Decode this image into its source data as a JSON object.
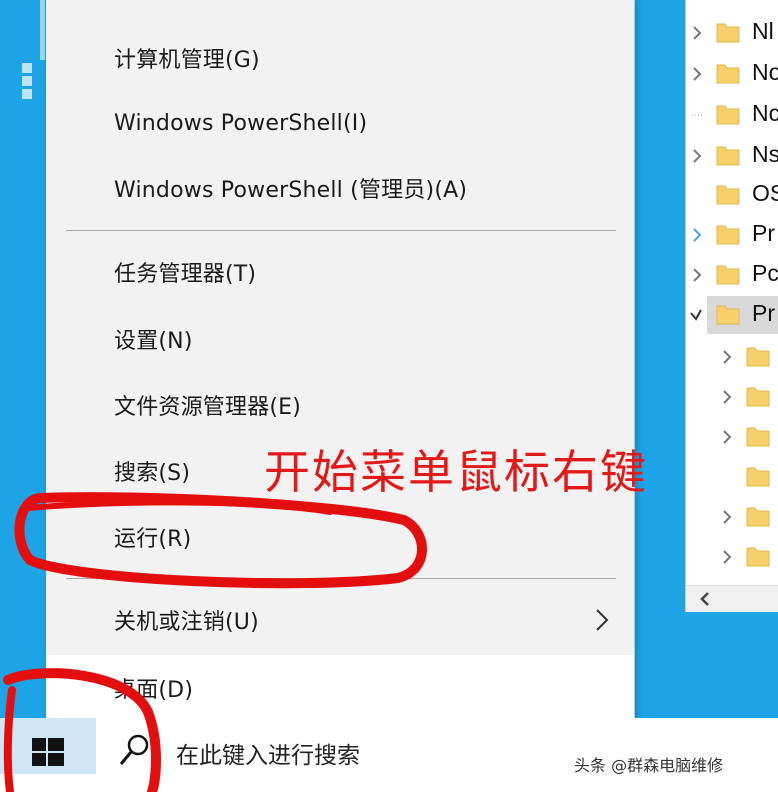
{
  "menu": {
    "items": [
      {
        "label": "计算机管理(G)"
      },
      {
        "label": "Windows PowerShell(I)"
      },
      {
        "label": "Windows PowerShell (管理员)(A)"
      },
      {
        "label": "任务管理器(T)"
      },
      {
        "label": "设置(N)"
      },
      {
        "label": "文件资源管理器(E)"
      },
      {
        "label": "搜索(S)"
      },
      {
        "label": "运行(R)"
      },
      {
        "label": "关机或注销(U)"
      },
      {
        "label": "桌面(D)"
      }
    ]
  },
  "explorer": {
    "rows": [
      {
        "label": "Nl"
      },
      {
        "label": "No"
      },
      {
        "label": "Nc"
      },
      {
        "label": "Ns"
      },
      {
        "label": "OS"
      },
      {
        "label": "Pr"
      },
      {
        "label": "Pc"
      },
      {
        "label": "Pr"
      }
    ]
  },
  "taskbar": {
    "search_placeholder": "在此键入进行搜索"
  },
  "annotation": {
    "text": "开始菜单鼠标右键",
    "color": "#e11919"
  },
  "watermark": "头条 @群森电脑维修"
}
